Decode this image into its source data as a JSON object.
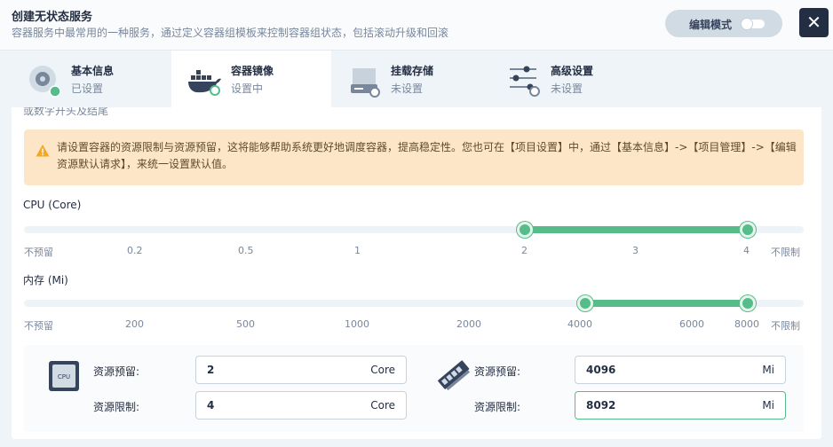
{
  "header": {
    "title": "创建无状态服务",
    "description": "容器服务中最常用的一种服务，通过定义容器组模板来控制容器组状态，包括滚动升级和回滚",
    "edit_mode_label": "编辑模式",
    "close_label": "✕"
  },
  "tabs": [
    {
      "title": "基本信息",
      "status": "已设置",
      "icon": "disk-icon",
      "active": false
    },
    {
      "title": "容器镜像",
      "status": "设置中",
      "icon": "docker-icon",
      "active": true
    },
    {
      "title": "挂载存储",
      "status": "未设置",
      "icon": "storage-icon",
      "active": false
    },
    {
      "title": "高级设置",
      "status": "未设置",
      "icon": "sliders-icon",
      "active": false
    }
  ],
  "panel": {
    "cut_text": "或数字开头及结尾",
    "warning": "请设置容器的资源限制与资源预留，这将能够帮助系统更好地调度容器，提高稳定性。您也可在【项目设置】中，通过【基本信息】->【项目管理】->【编辑资源默认请求】，来统一设置默认值。"
  },
  "cpu_slider": {
    "label": "CPU (Core)",
    "marks": [
      "不预留",
      "0.2",
      "0.5",
      "1",
      "2",
      "3",
      "4",
      "不限制"
    ],
    "selected_range": [
      2,
      4
    ]
  },
  "memory_slider": {
    "label": "内存 (Mi)",
    "marks": [
      "不预留",
      "200",
      "500",
      "1000",
      "2000",
      "4000",
      "6000",
      "8000",
      "不限制"
    ],
    "selected_range": [
      4000,
      8000
    ]
  },
  "resources": {
    "cpu_icon_text": "CPU",
    "cpu_request_label": "资源预留:",
    "cpu_request_value": "2",
    "cpu_request_unit": "Core",
    "cpu_limit_label": "资源限制:",
    "cpu_limit_value": "4",
    "cpu_limit_unit": "Core",
    "mem_request_label": "资源预留:",
    "mem_request_value": "4096",
    "mem_request_unit": "Mi",
    "mem_limit_label": "资源限制:",
    "mem_limit_value": "8092",
    "mem_limit_unit": "Mi"
  },
  "colors": {
    "accent": "#55bc8a",
    "warning_bg": "#fde6c8",
    "dark": "#242e42"
  }
}
